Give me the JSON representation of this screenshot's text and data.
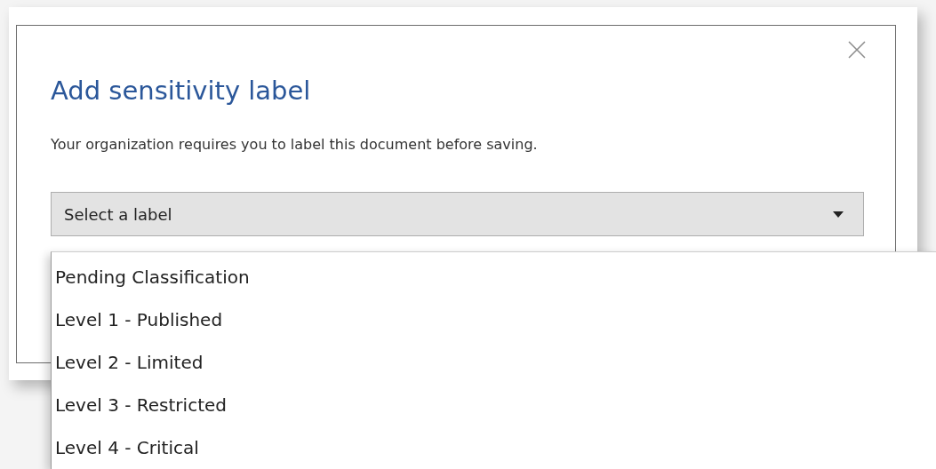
{
  "dialog": {
    "title": "Add sensitivity label",
    "message": "Your organization requires you to label this document before saving.",
    "select": {
      "placeholder": "Select a label",
      "expanded": true
    }
  },
  "options": [
    {
      "label": "Pending Classification",
      "selected": false
    },
    {
      "label": "Level 1 - Published",
      "selected": false
    },
    {
      "label": "Level 2 - Limited",
      "selected": false
    },
    {
      "label": "Level 3 - Restricted",
      "selected": false
    },
    {
      "label": "Level 4 - Critical",
      "selected": false
    }
  ]
}
